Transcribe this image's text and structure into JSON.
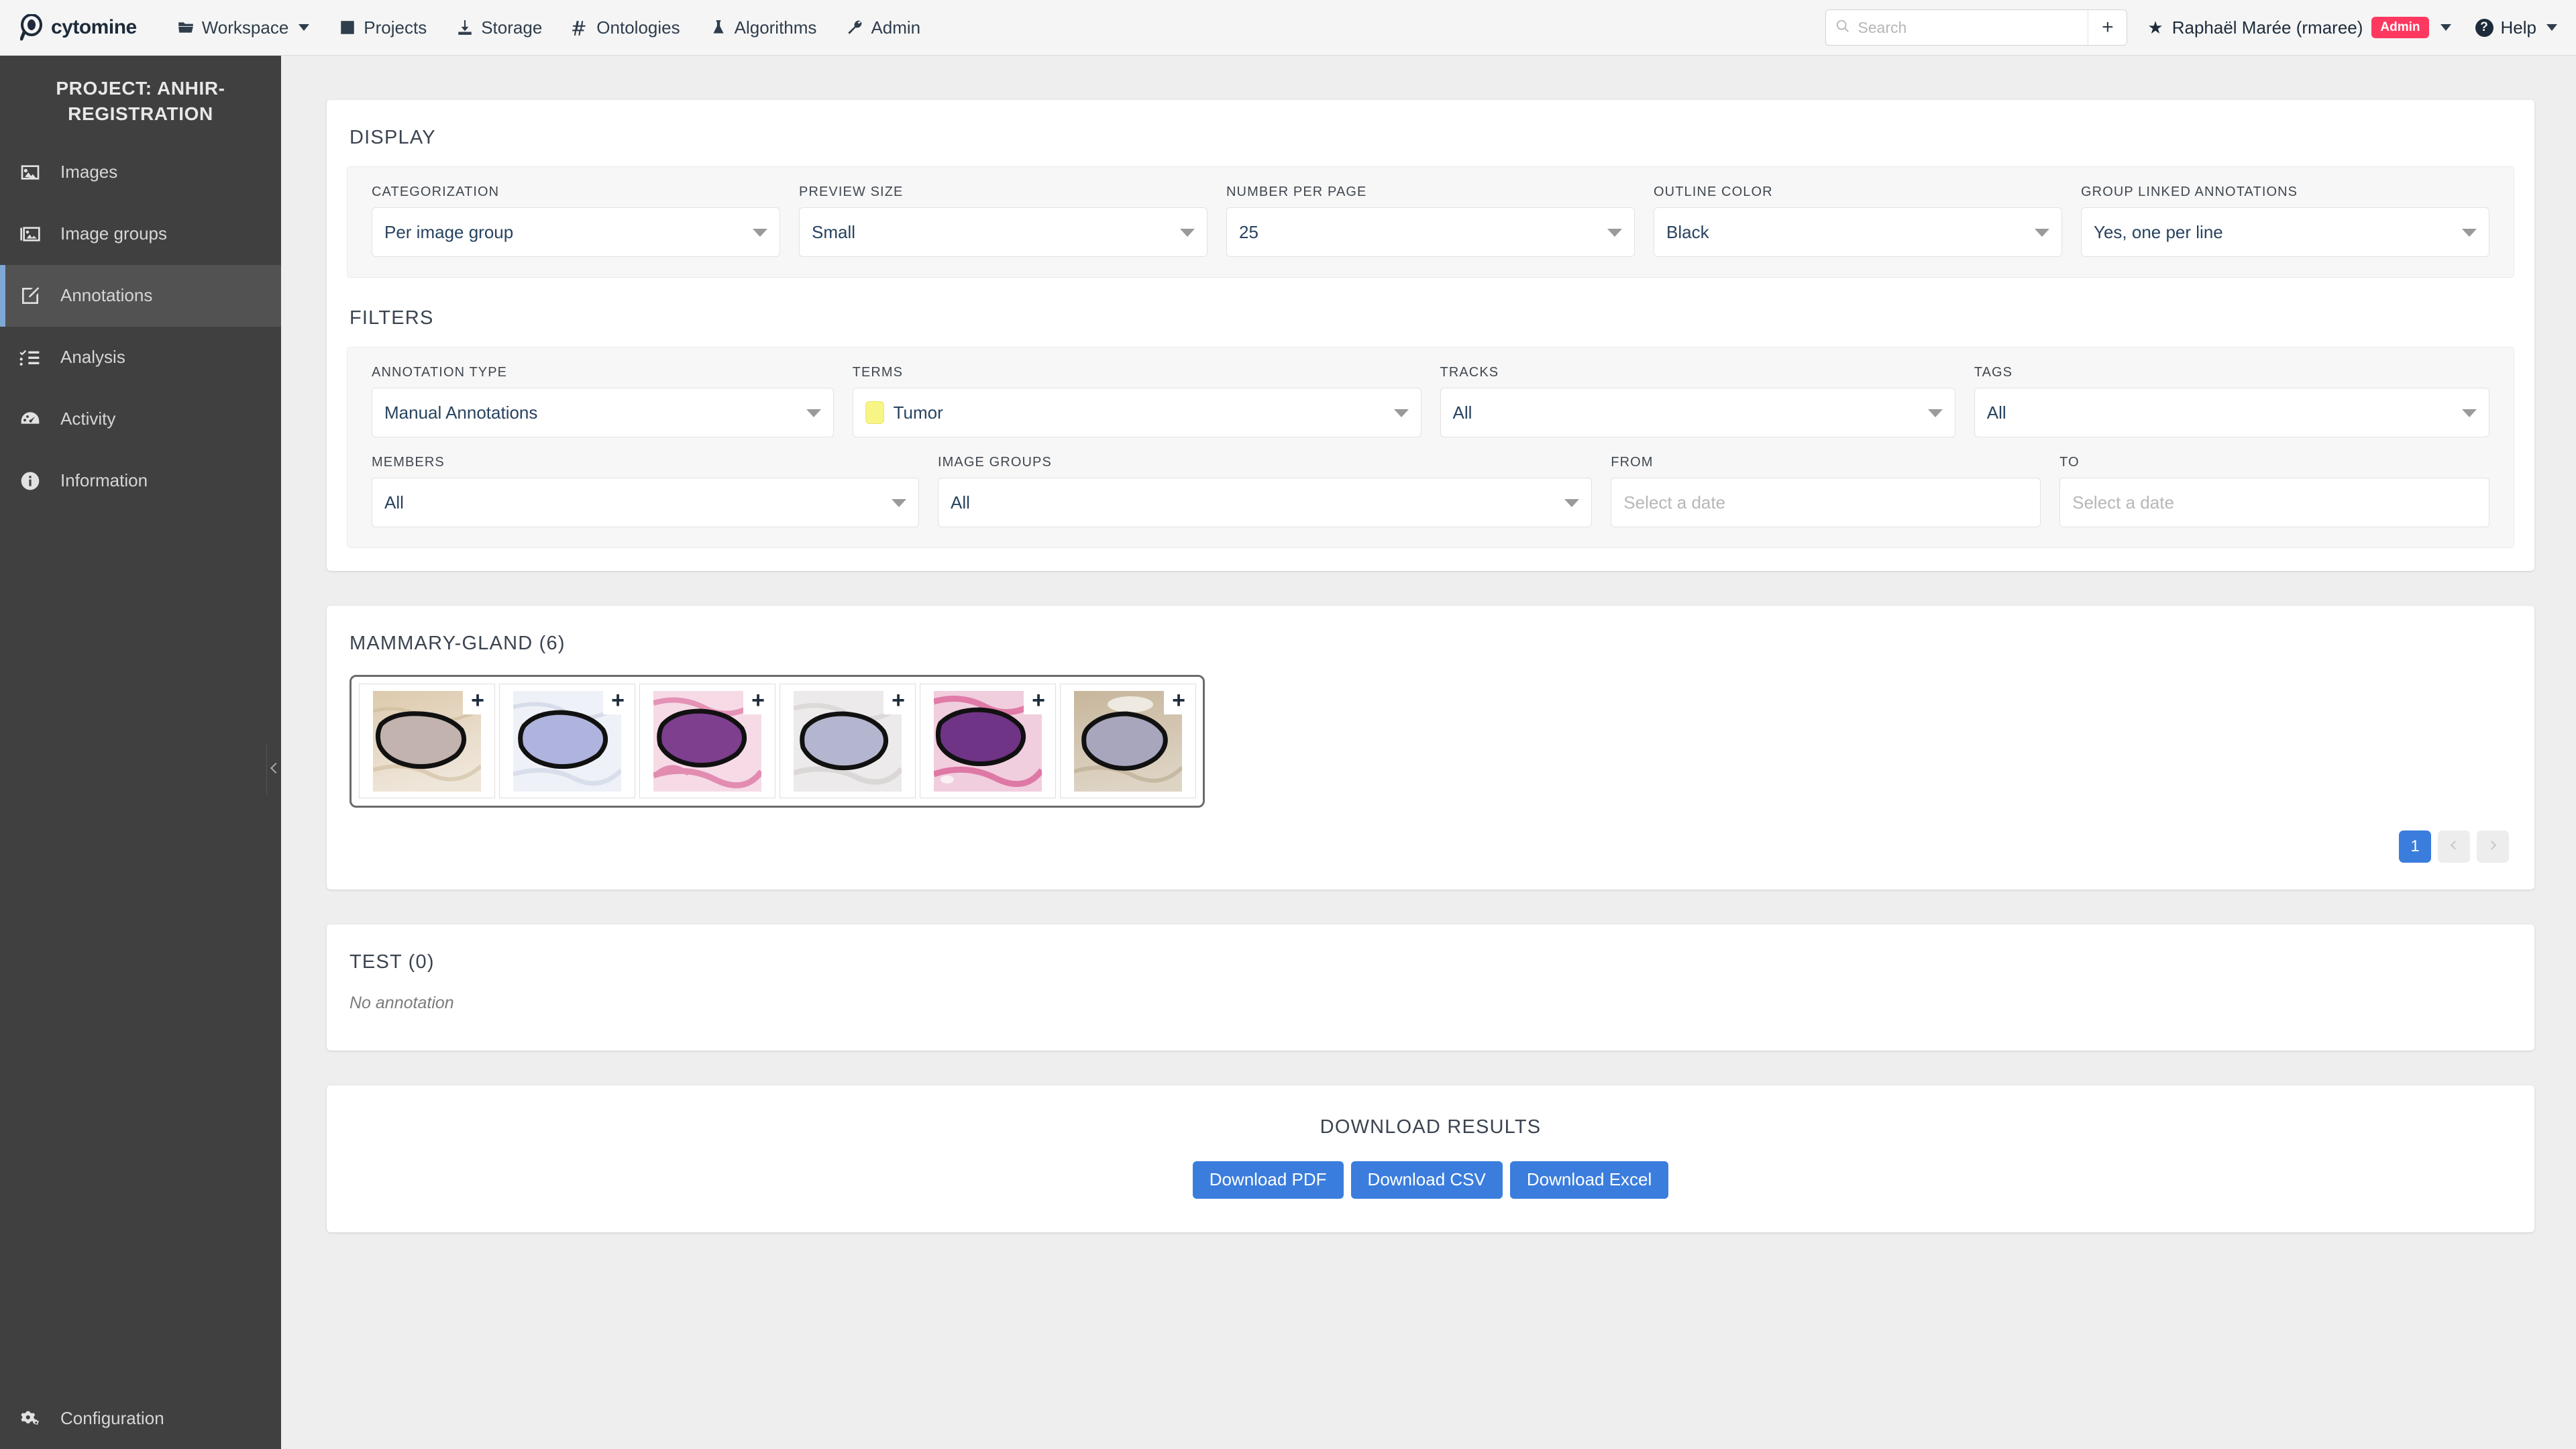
{
  "navbar": {
    "brand": "cytomine",
    "items": [
      {
        "label": "Workspace",
        "icon": "folder-icon",
        "has_caret": true
      },
      {
        "label": "Projects",
        "icon": "list-icon",
        "has_caret": false
      },
      {
        "label": "Storage",
        "icon": "download-icon",
        "has_caret": false
      },
      {
        "label": "Ontologies",
        "icon": "hash-icon",
        "has_caret": false
      },
      {
        "label": "Algorithms",
        "icon": "flask-icon",
        "has_caret": false
      },
      {
        "label": "Admin",
        "icon": "wrench-icon",
        "has_caret": false
      }
    ],
    "search": {
      "placeholder": "Search",
      "value": "",
      "add_label": "+"
    },
    "user": {
      "name": "Raphaël Marée (rmaree)",
      "badge": "Admin"
    },
    "help": {
      "label": "Help"
    }
  },
  "sidebar": {
    "project_title": "PROJECT: ANHIR-REGISTRATION",
    "items": [
      {
        "label": "Images",
        "icon": "image-icon",
        "active": false
      },
      {
        "label": "Image groups",
        "icon": "images-stack-icon",
        "active": false
      },
      {
        "label": "Annotations",
        "icon": "edit-square-icon",
        "active": true
      },
      {
        "label": "Analysis",
        "icon": "checklist-icon",
        "active": false
      },
      {
        "label": "Activity",
        "icon": "gauge-icon",
        "active": false
      },
      {
        "label": "Information",
        "icon": "info-circle-icon",
        "active": false
      }
    ],
    "footer": {
      "label": "Configuration",
      "icon": "gears-icon"
    }
  },
  "display": {
    "title": "DISPLAY",
    "fields": [
      {
        "label": "CATEGORIZATION",
        "value": "Per image group"
      },
      {
        "label": "PREVIEW SIZE",
        "value": "Small"
      },
      {
        "label": "NUMBER PER PAGE",
        "value": "25"
      },
      {
        "label": "OUTLINE COLOR",
        "value": "Black"
      },
      {
        "label": "GROUP LINKED ANNOTATIONS",
        "value": "Yes, one per line"
      }
    ]
  },
  "filters": {
    "title": "FILTERS",
    "row1": [
      {
        "label": "ANNOTATION TYPE",
        "value": "Manual Annotations"
      },
      {
        "label": "TERMS",
        "value": "Tumor",
        "swatch": "#f7f585"
      },
      {
        "label": "TRACKS",
        "value": "All"
      },
      {
        "label": "TAGS",
        "value": "All"
      }
    ],
    "row2": [
      {
        "label": "MEMBERS",
        "value": "All"
      },
      {
        "label": "IMAGE GROUPS",
        "value": "All"
      },
      {
        "label": "FROM",
        "value": "",
        "placeholder": "Select a date"
      },
      {
        "label": "TO",
        "value": "",
        "placeholder": "Select a date"
      }
    ]
  },
  "results": {
    "groups": [
      {
        "title": "MAMMARY-GLAND (6)",
        "count": 6,
        "thumbnails": [
          {
            "badge": "+",
            "bg_top": "#ddcaad",
            "bg_bottom": "#efe6da",
            "fill": "#c2b3ae",
            "outline": "#111111"
          },
          {
            "badge": "+",
            "bg_top": "#eef1f7",
            "bg_bottom": "#e6eaf3",
            "fill": "#aeb4dd",
            "outline": "#111111"
          },
          {
            "badge": "+",
            "bg_top": "#f3c7da",
            "bg_bottom": "#f6dbe7",
            "fill": "#7d3f8e",
            "outline": "#111111"
          },
          {
            "badge": "+",
            "bg_top": "#e8e6e4",
            "bg_bottom": "#eceaea",
            "fill": "#b4b6cf",
            "outline": "#111111"
          },
          {
            "badge": "+",
            "bg_top": "#eeb7cd",
            "bg_bottom": "#f1cede",
            "fill": "#6f3486",
            "outline": "#111111"
          },
          {
            "badge": "+",
            "bg_top": "#c7b69c",
            "bg_bottom": "#ded4c4",
            "fill": "#a8a6bd",
            "outline": "#111111"
          }
        ],
        "pagination": {
          "current": "1",
          "prev_icon": "chevron-left-icon",
          "next_icon": "chevron-right-icon"
        }
      },
      {
        "title": "TEST (0)",
        "count": 0,
        "empty_message": "No annotation"
      }
    ]
  },
  "download": {
    "title": "DOWNLOAD RESULTS",
    "buttons": [
      "Download PDF",
      "Download CSV",
      "Download Excel"
    ]
  },
  "colors": {
    "accent": "#3b7ddd",
    "admin_badge": "#ff3860",
    "sidebar_bg": "#404040",
    "sidebar_active": "#525252",
    "sidebar_marker": "#7fa8d4"
  }
}
